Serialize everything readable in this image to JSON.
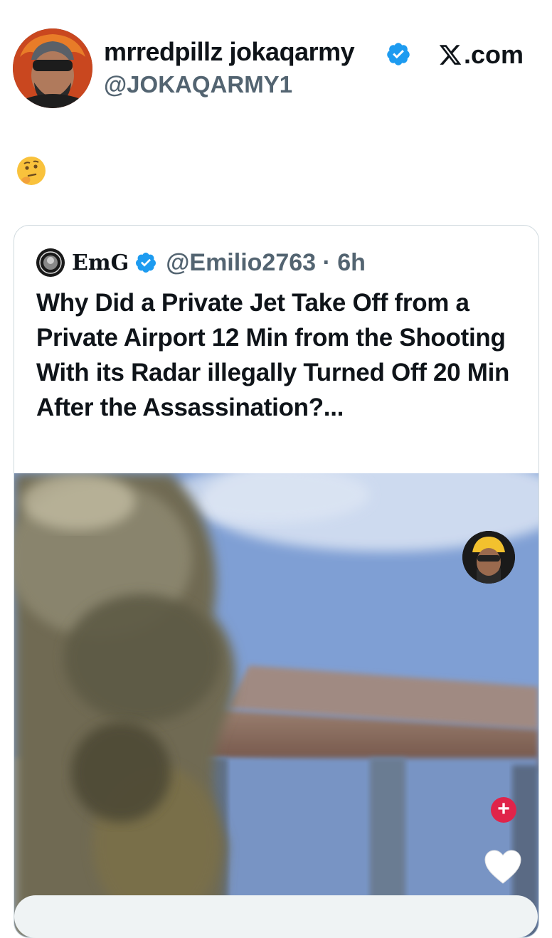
{
  "post": {
    "display_name": "mrredpillz jokaqarmy",
    "handle": "@JOKAQARMY1",
    "brand": ".com",
    "body_emoji": "🤔"
  },
  "quoted": {
    "name": "EmG",
    "handle_time": "@Emilio2763 · 6h",
    "text": "Why Did a Private Jet Take Off from a Private Airport 12 Min from the Shooting With its Radar illegally Turned Off 20 Min After the Assassination?..."
  },
  "media_overlay": {
    "follow_plus": "+"
  },
  "colors": {
    "verified": "#1d9bf0",
    "secondary_text": "#536471",
    "follow_red": "#e0244a"
  }
}
